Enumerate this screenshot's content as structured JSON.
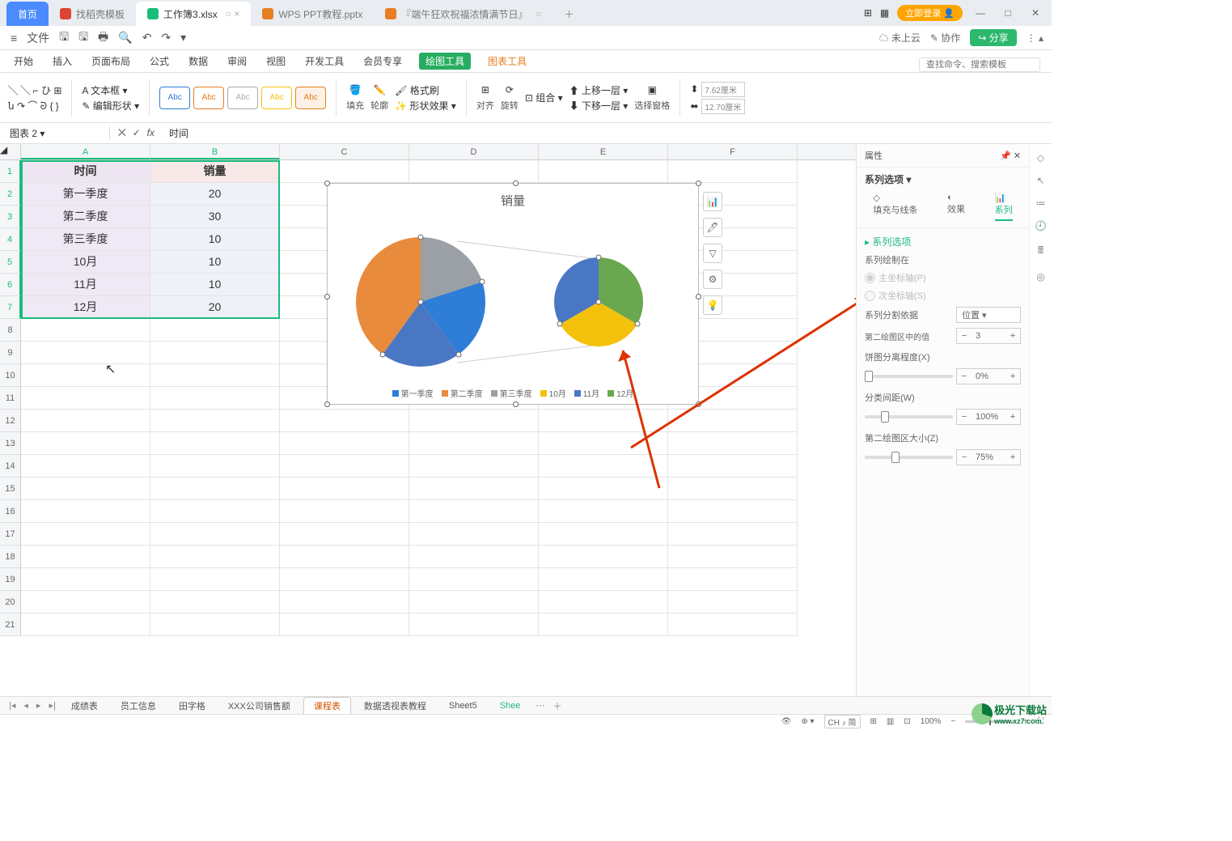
{
  "titlebar": {
    "home": "首页",
    "tabs": [
      {
        "label": "找稻壳模板"
      },
      {
        "label": "工作簿3.xlsx",
        "active": true
      },
      {
        "label": "WPS PPT教程.pptx"
      },
      {
        "label": "『端午狂欢祝福浓情满节日』"
      }
    ],
    "login": "立即登录"
  },
  "filerow": {
    "file": "文件"
  },
  "sharing": {
    "cloud": "未上云",
    "collab": "协作",
    "share": "分享"
  },
  "menus": [
    "开始",
    "插入",
    "页面布局",
    "公式",
    "数据",
    "审阅",
    "视图",
    "开发工具",
    "会员专享",
    "绘图工具",
    "图表工具"
  ],
  "search_ph": "查找命令、搜索模板",
  "ribbon": {
    "textbox": "文本框",
    "editshape": "编辑形状",
    "fill": "填充",
    "outline": "轮廓",
    "fmtpaint": "格式刷",
    "shapefx": "形状效果",
    "align": "对齐",
    "rotate": "旋转",
    "group": "组合",
    "upone": "上移一层",
    "downone": "下移一层",
    "selpane": "选择窗格",
    "size1": "7.62厘米",
    "size2": "12.70厘米"
  },
  "abc_colors": [
    "#2e7dd7",
    "#e67e22",
    "#aaaaaa",
    "#f4c20d",
    "#e67e22"
  ],
  "namebox": "图表 2",
  "formula": "时间",
  "cols": [
    "A",
    "B",
    "C",
    "D",
    "E",
    "F"
  ],
  "row_nums": [
    1,
    2,
    3,
    4,
    5,
    6,
    7,
    8,
    9,
    10,
    11,
    12,
    13,
    14,
    15,
    16,
    17,
    18,
    19,
    20,
    21
  ],
  "table": {
    "h1": "时间",
    "h2": "销量",
    "r": [
      {
        "a": "第一季度",
        "b": "20"
      },
      {
        "a": "第二季度",
        "b": "30"
      },
      {
        "a": "第三季度",
        "b": "10"
      },
      {
        "a": "10月",
        "b": "10"
      },
      {
        "a": "11月",
        "b": "10"
      },
      {
        "a": "12月",
        "b": "20"
      }
    ]
  },
  "chart_data": {
    "type": "pie",
    "title": "销量",
    "categories": [
      "第一季度",
      "第二季度",
      "第三季度",
      "10月",
      "11月",
      "12月"
    ],
    "values": [
      20,
      30,
      10,
      10,
      10,
      20
    ],
    "colors": [
      "#2e7dd7",
      "#e98b3d",
      "#9aa0a6",
      "#f4c20d",
      "#4a77c4",
      "#6aa84f"
    ],
    "split_by": "位置",
    "second_plot_count": 3,
    "explosion_pct": 0,
    "gap_width_pct": 100,
    "second_plot_size_pct": 75
  },
  "prop": {
    "title": "属性",
    "series_opts": "系列选项",
    "tab_fill": "填充与线条",
    "tab_fx": "效果",
    "tab_series": "系列",
    "sec_series": "系列选项",
    "sec_drawn": "系列绘制在",
    "opt_primary": "主坐标轴(P)",
    "opt_secondary": "次坐标轴(S)",
    "lbl_split": "系列分割依据",
    "val_split": "位置",
    "lbl_second_val": "第二绘图区中的值",
    "val_second_val": "3",
    "lbl_explode": "饼图分离程度(X)",
    "val_explode": "0%",
    "lbl_gap": "分类间距(W)",
    "val_gap": "100%",
    "lbl_size2": "第二绘图区大小(Z)",
    "val_size2": "75%"
  },
  "sheets": [
    "成绩表",
    "员工信息",
    "田字格",
    "XXX公司销售额",
    "课程表",
    "数据透视表教程",
    "Sheet5",
    "Shee"
  ],
  "active_sheet": 4,
  "status": {
    "ime": "CH ♪ 简",
    "zoom": "100%"
  },
  "watermark": {
    "name": "极光下载站",
    "url": "www.xz7.com"
  }
}
